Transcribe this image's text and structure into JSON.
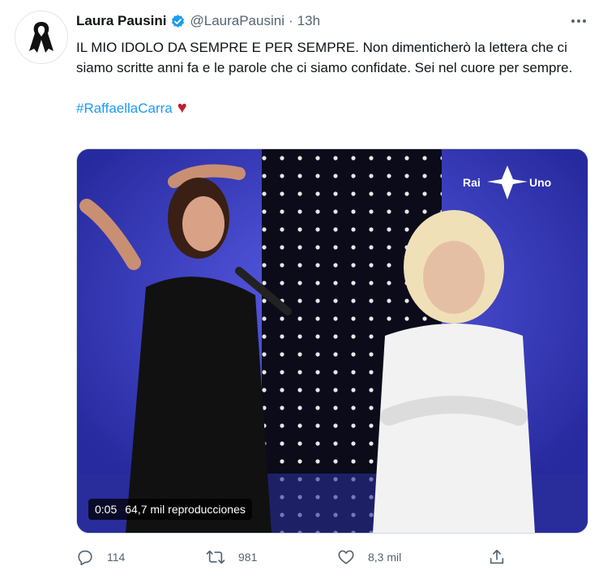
{
  "author": {
    "name": "Laura Pausini",
    "handle": "@LauraPausini",
    "separator": "·",
    "time": "13h"
  },
  "tweet": {
    "text": "IL MIO IDOLO DA SEMPRE E PER SEMPRE. Non dimenticherò la lettera che ci siamo scritte anni fa e le parole che ci siamo confidate. Sei nel cuore per sempre.",
    "hashtag": "#RaffaellaCarra",
    "heart_emoji": "♥"
  },
  "media": {
    "broadcaster_logo_text": [
      "Rai",
      "Uno"
    ],
    "duration": "0:05",
    "views": "64,7 mil reproducciones"
  },
  "actions": {
    "reply_count": "114",
    "retweet_count": "981",
    "like_count": "8,3 mil"
  },
  "icons": {
    "avatar": "black-ribbon-icon",
    "verified": "verified-badge-icon",
    "more": "more-icon",
    "reply": "reply-icon",
    "retweet": "retweet-icon",
    "like": "heart-icon",
    "share": "share-icon"
  },
  "colors": {
    "accent": "#1d9bf0",
    "secondary_text": "#536471",
    "heart_emoji": "#be1e2d",
    "stage_blue": "#3d3fc4"
  }
}
